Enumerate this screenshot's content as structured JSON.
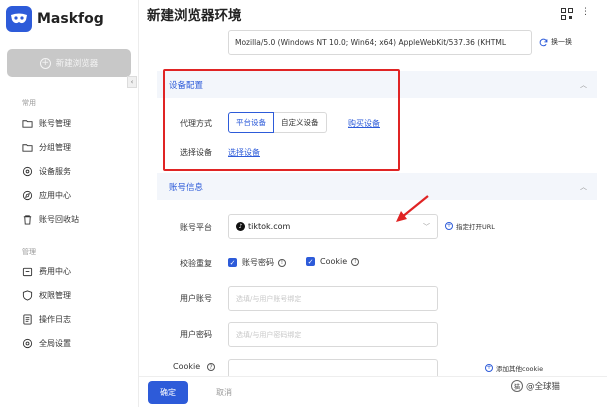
{
  "app": {
    "name": "Maskfog",
    "page_title": "新建浏览器环境"
  },
  "sidebar": {
    "new_browser_label": "新建浏览器",
    "groups": [
      {
        "label": "常用",
        "items": [
          {
            "label": "账号管理",
            "icon": "folder-icon"
          },
          {
            "label": "分组管理",
            "icon": "folder-icon"
          },
          {
            "label": "设备服务",
            "icon": "location-pin-icon"
          },
          {
            "label": "应用中心",
            "icon": "compass-icon"
          },
          {
            "label": "账号回收站",
            "icon": "trash-icon"
          }
        ]
      },
      {
        "label": "管理",
        "items": [
          {
            "label": "费用中心",
            "icon": "wallet-icon"
          },
          {
            "label": "权限管理",
            "icon": "shield-icon"
          },
          {
            "label": "操作日志",
            "icon": "document-icon"
          },
          {
            "label": "全局设置",
            "icon": "gear-icon"
          }
        ]
      }
    ]
  },
  "ua": {
    "value": "Mozilla/5.0 (Windows NT 10.0; Win64; x64) AppleWebKit/537.36 (KHTML",
    "switch_label": "换一换"
  },
  "device_config": {
    "title": "设备配置",
    "proxy_label": "代理方式",
    "proxy_options": [
      "平台设备",
      "自定义设备"
    ],
    "proxy_selected": "平台设备",
    "buy_link": "购买设备",
    "select_label": "选择设备",
    "select_link": "选择设备"
  },
  "account_info": {
    "title": "账号信息",
    "platform_label": "账号平台",
    "platform_value": "tiktok.com",
    "url_hint": "指定打开URL",
    "dup_check_label": "校验重复",
    "dup_checks": [
      {
        "label": "账号密码",
        "checked": true
      },
      {
        "label": "Cookie",
        "checked": true
      }
    ],
    "user_account_label": "用户账号",
    "user_account_placeholder": "选填/与用户账号绑定",
    "user_password_label": "用户密码",
    "user_password_placeholder": "选填/与用户密码绑定",
    "cookie_label": "Cookie",
    "add_cookie": "添加其他cookie"
  },
  "footer": {
    "ok_label": "确定",
    "cancel_label": "取消"
  },
  "watermark": "@全球猫",
  "colors": {
    "accent": "#2d5bd9",
    "highlight_frame": "#e02424",
    "section_bg": "#f3f6fb"
  }
}
